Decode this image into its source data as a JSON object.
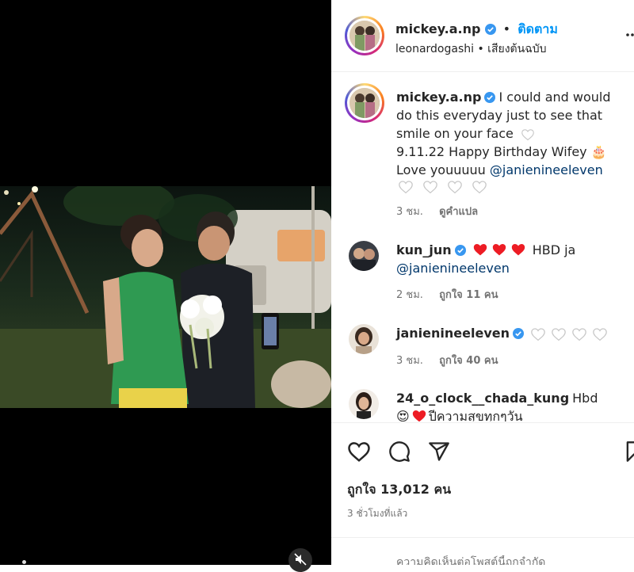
{
  "post": {
    "author": "mickey.a.np",
    "follow_label": "ติดตาม",
    "separator": "•",
    "audio": "leonardogashi • เสียงต้นฉบับ"
  },
  "caption": {
    "username": "mickey.a.np",
    "line1": "I could and would",
    "line2": "do this everyday just to see that",
    "line3": "smile on your face",
    "line4": "9.11.22 Happy Birthday Wifey 🎂",
    "line5_text": "Love youuuuu ",
    "line5_mention": "@janienineeleven",
    "time": "3 ชม.",
    "translate_label": "ดูคำแปล"
  },
  "comments": [
    {
      "username": "kun_jun",
      "text": "HBD ja",
      "mention": "@janienineeleven",
      "time": "2 ชม.",
      "likes_label": "ถูกใจ 11 คน"
    },
    {
      "username": "janienineeleven",
      "time": "3 ชม.",
      "likes_label": "ถูกใจ 40 คน"
    },
    {
      "username": "24_o_clock__chada_kung",
      "text": "Hbd",
      "text2": "ปีความสุขทุกๆวัน"
    }
  ],
  "footer": {
    "likes": "ถูกใจ 13,012 คน",
    "time": "3 ชั่วโมงที่แล้ว",
    "add_comment_placeholder": "ความคิดเห็นต่อโพสต์นี้ถูกจำกัด"
  },
  "colors": {
    "accent": "#0095f6",
    "heart_red": "#ed1c24",
    "mention": "#00376b",
    "muted": "#737373"
  },
  "icons": [
    "verified-icon",
    "more-icon",
    "heart-icon",
    "comment-icon",
    "share-icon",
    "bookmark-icon",
    "mute-icon"
  ]
}
